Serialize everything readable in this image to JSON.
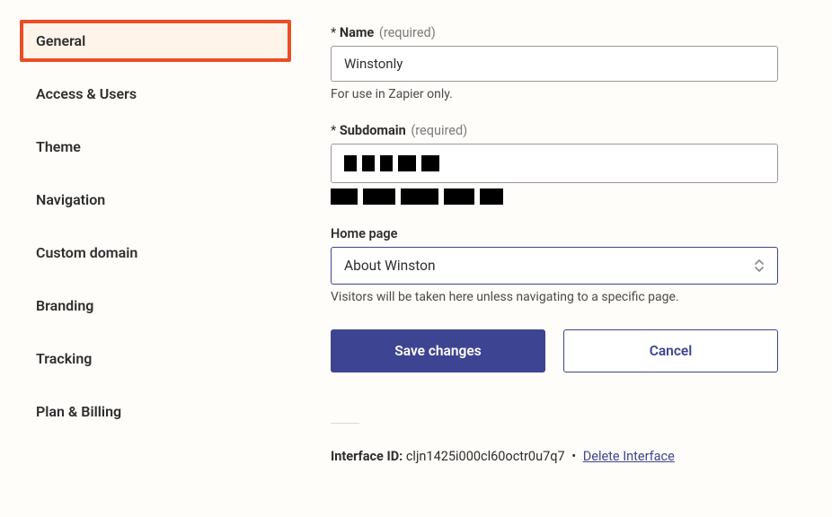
{
  "sidebar": {
    "items": [
      {
        "label": "General",
        "active": true
      },
      {
        "label": "Access & Users",
        "active": false
      },
      {
        "label": "Theme",
        "active": false
      },
      {
        "label": "Navigation",
        "active": false
      },
      {
        "label": "Custom domain",
        "active": false
      },
      {
        "label": "Branding",
        "active": false
      },
      {
        "label": "Tracking",
        "active": false
      },
      {
        "label": "Plan & Billing",
        "active": false
      }
    ]
  },
  "form": {
    "name": {
      "asterisk": "*",
      "label": "Name",
      "required": "(required)",
      "value": "Winstonly",
      "helper": "For use in Zapier only."
    },
    "subdomain": {
      "asterisk": "*",
      "label": "Subdomain",
      "required": "(required)"
    },
    "homepage": {
      "label": "Home page",
      "value": "About Winston",
      "helper": "Visitors will be taken here unless navigating to a specific page."
    },
    "buttons": {
      "save": "Save changes",
      "cancel": "Cancel"
    },
    "footer": {
      "label": "Interface ID:",
      "id": "cljn1425i000cl60octr0u7q7",
      "separator": "•",
      "delete": "Delete Interface"
    }
  }
}
